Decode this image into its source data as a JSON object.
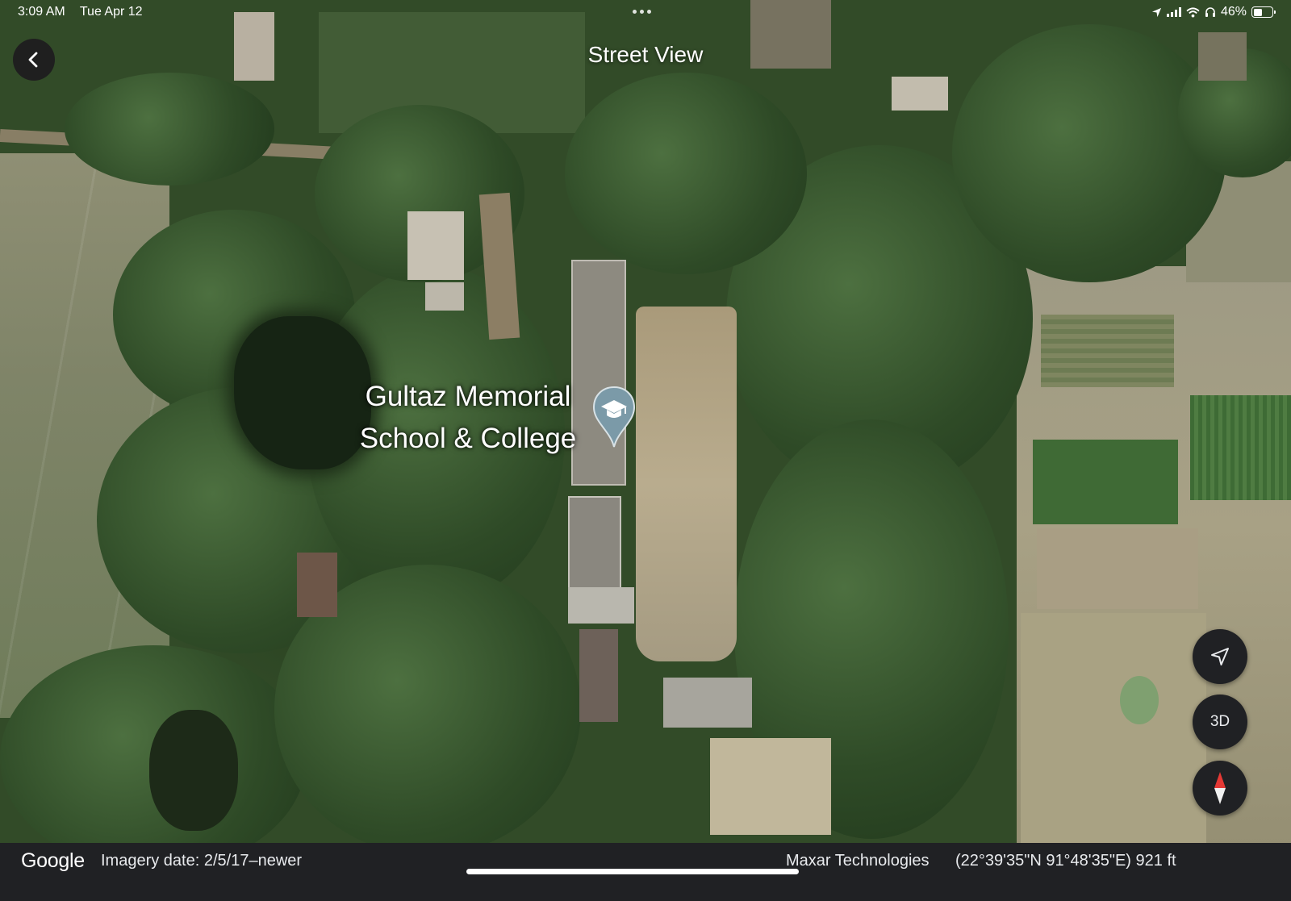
{
  "status_bar": {
    "time": "3:09 AM",
    "date": "Tue Apr 12",
    "battery_text": "46%",
    "battery_level": 0.46,
    "icons": [
      "location-arrow-icon",
      "cellular-signal-icon",
      "wifi-icon",
      "headphones-icon",
      "battery-icon"
    ]
  },
  "header": {
    "title": "Street View",
    "back_icon": "chevron-left-icon"
  },
  "map": {
    "place": {
      "name_line1": "Gultaz Memorial",
      "name_line2": "School & College",
      "pin_icon": "graduation-cap-icon",
      "pin_color": "#7b9aa8"
    }
  },
  "controls": {
    "locate_icon": "navigation-arrow-icon",
    "view_3d_label": "3D",
    "compass_icon": "compass-needle-icon"
  },
  "footer": {
    "logo": "Google",
    "imagery_date": "Imagery date: 2/5/17–newer",
    "provider": "Maxar Technologies",
    "coordinates": "(22°39'35\"N 91°48'35\"E) 921 ft"
  },
  "colors": {
    "panel_bg": "#202124",
    "compass_red": "#e53935"
  }
}
